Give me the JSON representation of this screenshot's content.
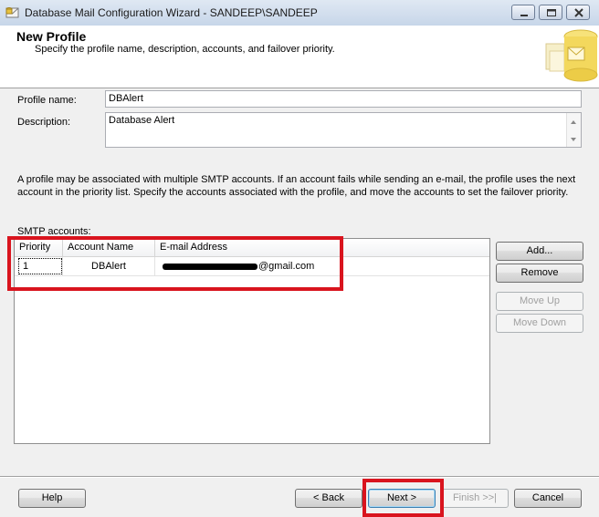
{
  "window": {
    "title": "Database Mail Configuration Wizard - SANDEEP\\SANDEEP"
  },
  "header": {
    "title": "New Profile",
    "subtitle": "Specify the profile name, description, accounts, and failover priority."
  },
  "form": {
    "profile_name_label": "Profile name:",
    "profile_name_value": "DBAlert",
    "description_label": "Description:",
    "description_value": "Database Alert"
  },
  "info_text": "A profile may be associated with multiple SMTP accounts. If an account fails while sending an e-mail, the profile uses the next account in the priority list. Specify the accounts associated with the profile, and move the accounts to set the failover priority.",
  "smtp": {
    "label": "SMTP accounts:",
    "columns": [
      "Priority",
      "Account Name",
      "E-mail Address"
    ],
    "rows": [
      {
        "priority": "1",
        "account_name": "DBAlert",
        "email_suffix": "@gmail.com"
      }
    ]
  },
  "side_buttons": {
    "add": "Add...",
    "remove": "Remove",
    "move_up": "Move Up",
    "move_down": "Move Down"
  },
  "footer": {
    "help": "Help",
    "back": "< Back",
    "next": "Next >",
    "finish": "Finish >>|",
    "cancel": "Cancel"
  },
  "colors": {
    "highlight": "#d9141e",
    "title_bar": "#c7d6e9",
    "window_bg": "#f0f0f0"
  }
}
